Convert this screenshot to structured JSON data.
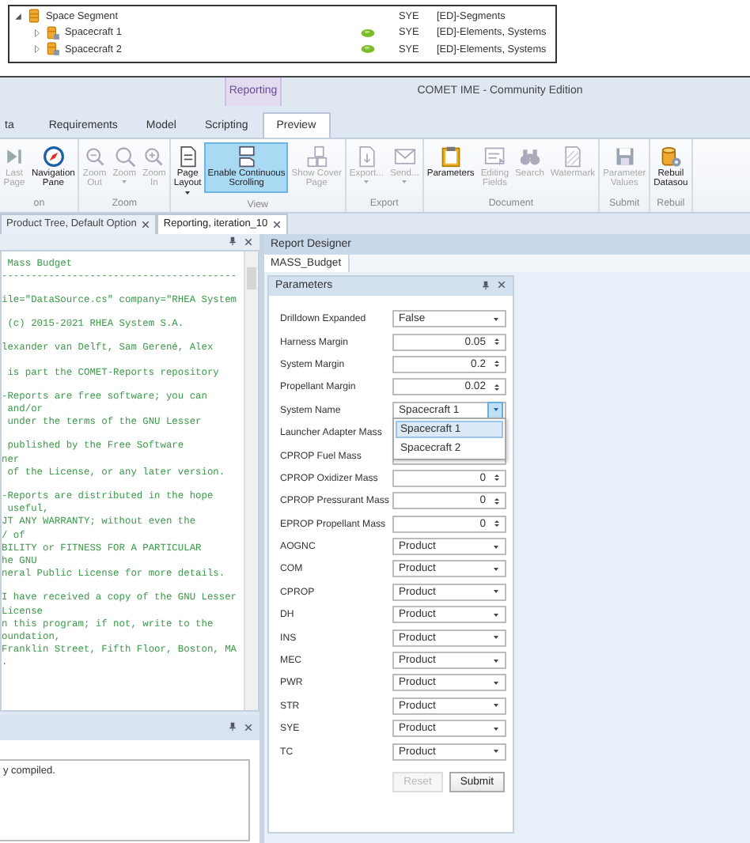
{
  "tree": {
    "rows": [
      {
        "name": "Space Segment",
        "kind": "segment",
        "expanded": true,
        "owner": "SYE",
        "category": "[ED]-Segments",
        "children": [
          {
            "name": "Spacecraft 1",
            "kind": "element",
            "expanded": false,
            "owner": "SYE",
            "category": "[ED]-Elements, Systems"
          },
          {
            "name": "Spacecraft 2",
            "kind": "element",
            "expanded": false,
            "owner": "SYE",
            "category": "[ED]-Elements, Systems"
          }
        ]
      }
    ]
  },
  "window": {
    "title": "COMET IME - Community Edition",
    "context_tab": "Reporting",
    "tabs": [
      {
        "label": "ta",
        "selected": false
      },
      {
        "label": "Requirements",
        "selected": false
      },
      {
        "label": "Model",
        "selected": false
      },
      {
        "label": "Scripting",
        "selected": false
      },
      {
        "label": "Preview",
        "selected": true
      }
    ],
    "ribbon": {
      "groups": [
        {
          "label": "on",
          "buttons": [
            {
              "kind": "button",
              "label": [
                "Last",
                "Page"
              ],
              "disabled": true
            },
            {
              "kind": "button",
              "label": [
                "Navigation",
                "Pane"
              ],
              "disabled": false
            }
          ]
        },
        {
          "label": "Zoom",
          "buttons": [
            {
              "kind": "button",
              "label": [
                "Zoom",
                "Out"
              ],
              "disabled": true
            },
            {
              "kind": "button",
              "label": [
                "Zoom"
              ],
              "dropdown": true,
              "disabled": true
            },
            {
              "kind": "button",
              "label": [
                "Zoom",
                "In"
              ],
              "disabled": true
            }
          ]
        },
        {
          "label": "View",
          "buttons": [
            {
              "kind": "button",
              "label": [
                "Page",
                "Layout"
              ],
              "dropdown": true,
              "disabled": false
            },
            {
              "kind": "toggle",
              "label": [
                "Enable Continuous",
                "Scrolling"
              ],
              "disabled": false,
              "checked": true
            },
            {
              "kind": "button",
              "label": [
                "Show Cover",
                "Page"
              ],
              "disabled": true
            }
          ]
        },
        {
          "label": "Export",
          "buttons": [
            {
              "kind": "button",
              "label": [
                "Export..."
              ],
              "dropdown": true,
              "disabled": true
            },
            {
              "kind": "button",
              "label": [
                "Send..."
              ],
              "dropdown": true,
              "disabled": true
            }
          ]
        },
        {
          "label": "Document",
          "buttons": [
            {
              "kind": "button",
              "label": [
                "Parameters"
              ],
              "disabled": false
            },
            {
              "kind": "button",
              "label": [
                "Editing",
                "Fields"
              ],
              "disabled": true
            },
            {
              "kind": "button",
              "label": [
                "Search"
              ],
              "disabled": true
            },
            {
              "kind": "button",
              "label": [
                "Watermark"
              ],
              "disabled": true
            }
          ]
        },
        {
          "label": "Submit",
          "buttons": [
            {
              "kind": "button",
              "label": [
                "Parameter",
                "Values"
              ],
              "disabled": true
            }
          ]
        },
        {
          "label": "Rebuil",
          "buttons": [
            {
              "kind": "button",
              "label": [
                "Rebuil",
                "Datasou"
              ],
              "disabled": false
            }
          ]
        }
      ]
    }
  },
  "document_tabs": [
    {
      "label": "Product Tree, Default Option",
      "selected": false
    },
    {
      "label": "Reporting, iteration_10",
      "selected": true
    }
  ],
  "code_panel": {
    "paragraphs": [
      [
        " Mass Budget",
        "----------------------------------------"
      ],
      [
        "ile=\"DataSource.cs\" company=\"RHEA System"
      ],
      [
        " (c) 2015-2021 RHEA System S.A."
      ],
      [
        "lexander van Delft, Sam Gerené, Alex"
      ],
      [
        " is part the COMET-Reports repository"
      ],
      [
        "-Reports are free software; you can",
        " and/or",
        " under the terms of the GNU Lesser"
      ],
      [
        " published by the Free Software",
        "ner",
        " of the License, or any later version."
      ],
      [
        "-Reports are distributed in the hope",
        " useful,",
        "JT ANY WARRANTY; without even the",
        "/ of",
        "BILITY or FITNESS FOR A PARTICULAR",
        "he GNU",
        "neral Public License for more details."
      ],
      [
        "I have received a copy of the GNU Lesser",
        "License",
        "n this program; if not, write to the",
        "oundation,",
        "Franklin Street, Fifth Floor, Boston, MA",
        "."
      ]
    ]
  },
  "output_panel": {
    "text": "y compiled."
  },
  "report_designer": {
    "title": "Report Designer",
    "tab": "MASS_Budget",
    "parameters": {
      "title": "Parameters",
      "rows": [
        {
          "label": "Drilldown Expanded",
          "kind": "dropdown",
          "value": "False"
        },
        {
          "label": "Harness Margin",
          "kind": "spin",
          "value": "0.05"
        },
        {
          "label": "System Margin",
          "kind": "spin",
          "value": "0.2"
        },
        {
          "label": "Propellant Margin",
          "kind": "spin",
          "value": "0.02"
        },
        {
          "label": "System Name",
          "kind": "open_dropdown",
          "value": "Spacecraft 1",
          "options": [
            {
              "label": "Spacecraft 1",
              "selected": true
            },
            {
              "label": "Spacecraft 2",
              "selected": false
            }
          ]
        },
        {
          "label": "Launcher Adapter Mass",
          "kind": "covered"
        },
        {
          "label": "CPROP Fuel Mass",
          "kind": "spin"
        },
        {
          "label": "CPROP Oxidizer Mass",
          "kind": "spin",
          "value": "0"
        },
        {
          "label": "CPROP Pressurant Mass",
          "kind": "spin",
          "value": "0"
        },
        {
          "label": "EPROP Propellant Mass",
          "kind": "spin",
          "value": "0"
        },
        {
          "label": "AOGNC",
          "kind": "dropdown",
          "value": "Product"
        },
        {
          "label": "COM",
          "kind": "dropdown",
          "value": "Product"
        },
        {
          "label": "CPROP",
          "kind": "dropdown",
          "value": "Product"
        },
        {
          "label": "DH",
          "kind": "dropdown",
          "value": "Product"
        },
        {
          "label": "INS",
          "kind": "dropdown",
          "value": "Product"
        },
        {
          "label": "MEC",
          "kind": "dropdown",
          "value": "Product"
        },
        {
          "label": "PWR",
          "kind": "dropdown",
          "value": "Product"
        },
        {
          "label": "STR",
          "kind": "dropdown",
          "value": "Product"
        },
        {
          "label": "SYE",
          "kind": "dropdown",
          "value": "Product"
        },
        {
          "label": "TC",
          "kind": "dropdown",
          "value": "Product"
        }
      ],
      "buttons": [
        {
          "label": "Reset",
          "disabled": true
        },
        {
          "label": "Submit",
          "disabled": false
        }
      ]
    }
  }
}
